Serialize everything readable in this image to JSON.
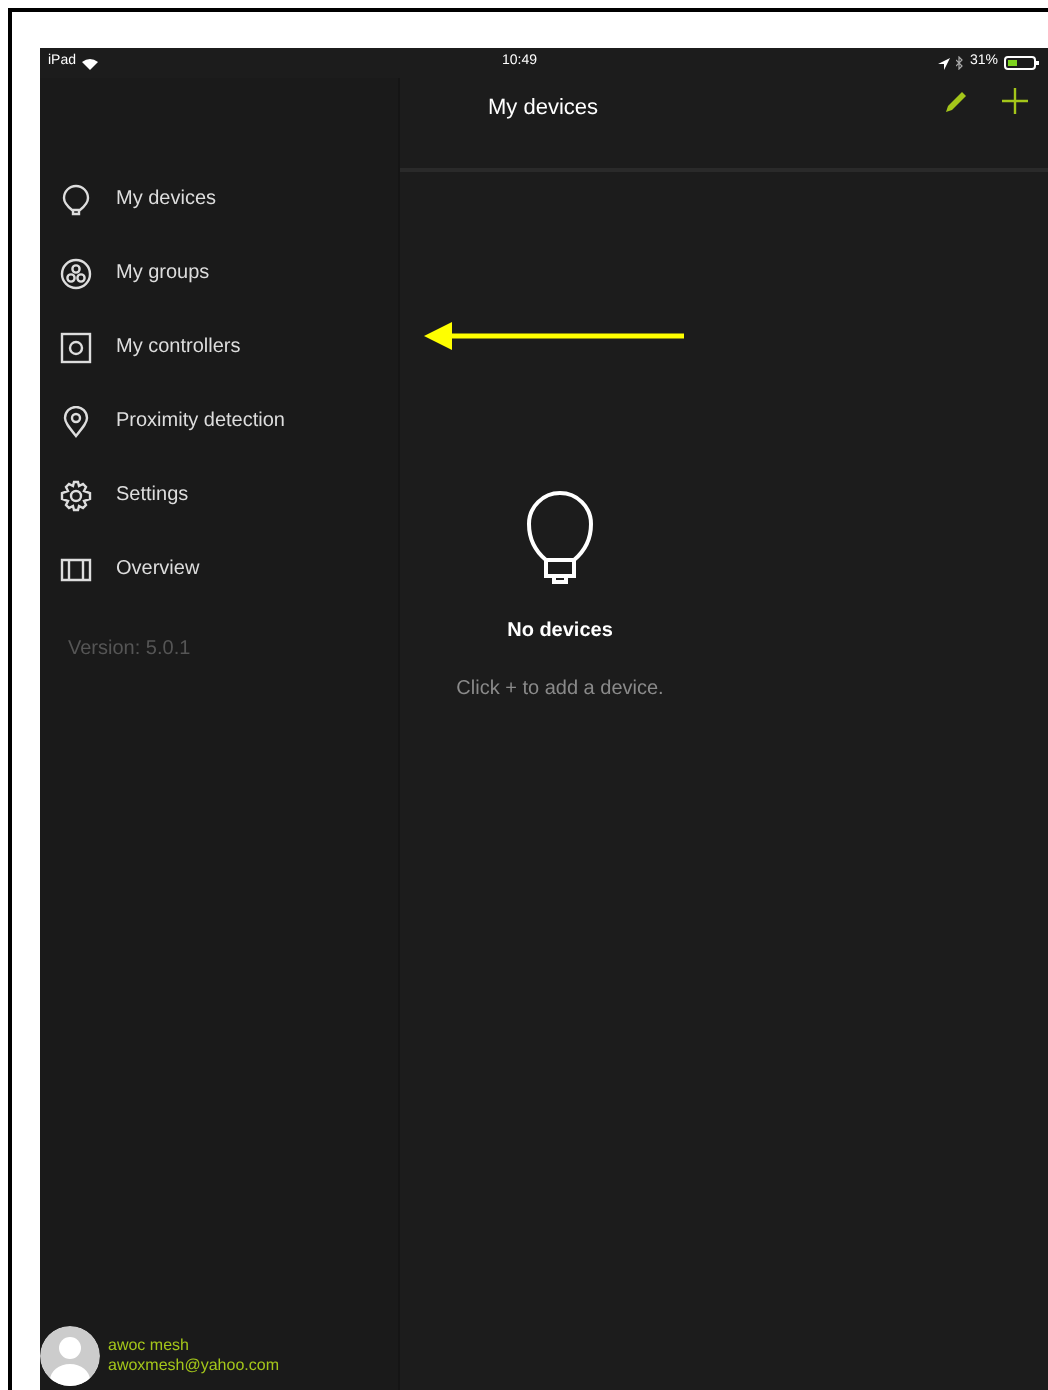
{
  "status_bar": {
    "device": "iPad",
    "time": "10:49",
    "battery": "31%"
  },
  "header": {
    "title": "My devices"
  },
  "sidebar": {
    "items": [
      {
        "kind": "bulb",
        "label": "My devices"
      },
      {
        "kind": "groups",
        "label": "My groups"
      },
      {
        "kind": "controller",
        "label": "My controllers"
      },
      {
        "kind": "pin",
        "label": "Proximity detection"
      },
      {
        "kind": "gear",
        "label": "Settings"
      },
      {
        "kind": "map",
        "label": "Overview"
      }
    ],
    "version": "Version: 5.0.1",
    "user": {
      "name": "awoc mesh",
      "email": "awoxmesh@yahoo.com"
    }
  },
  "empty_state": {
    "title": "No devices",
    "hint": "Click + to add a device."
  }
}
